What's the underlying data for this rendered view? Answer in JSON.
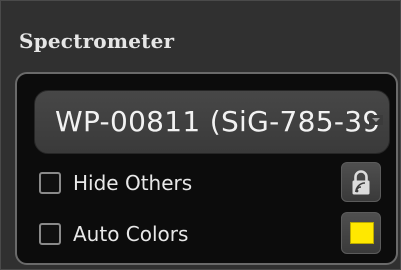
{
  "panel": {
    "title": "Spectrometer"
  },
  "spectrometer_select": {
    "selected": "WP-00811 (SiG-785-39"
  },
  "options": {
    "hide_others": {
      "label": "Hide Others",
      "checked": false
    },
    "auto_colors": {
      "label": "Auto Colors",
      "checked": false
    }
  },
  "buttons": {
    "lock_icon": "lock-signal-icon",
    "color_swatch": {
      "color": "#ffe800"
    }
  },
  "colors": {
    "panel_bg": "#303030",
    "group_bg": "#0c0c0c",
    "text": "#e8e8e8",
    "swatch": "#ffe800"
  }
}
